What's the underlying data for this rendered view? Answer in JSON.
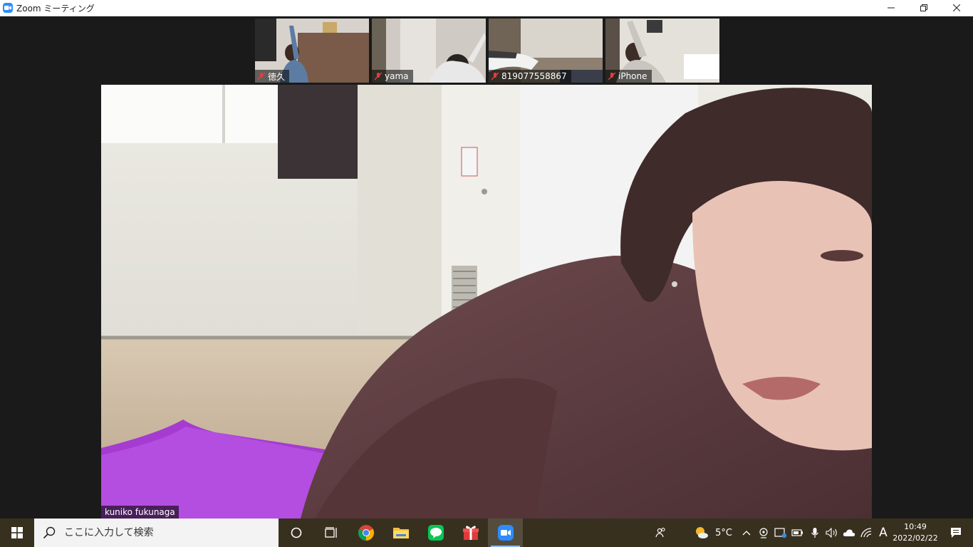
{
  "window": {
    "title": "Zoom ミーティング",
    "controls": [
      "minimize",
      "restore",
      "close"
    ]
  },
  "participants": [
    {
      "name": "徳久",
      "muted": true
    },
    {
      "name": "yama",
      "muted": true
    },
    {
      "name": "819077558867",
      "muted": true
    },
    {
      "name": "iPhone",
      "muted": true
    }
  ],
  "active_speaker": {
    "name": "kuniko fukunaga"
  },
  "taskbar": {
    "search_placeholder": "ここに入力して検索",
    "apps": [
      "cortana-icon",
      "task-view-icon",
      "chrome-icon",
      "file-explorer-icon",
      "line-icon",
      "gift-icon",
      "zoom-icon"
    ],
    "active_app": "zoom-icon"
  },
  "tray": {
    "temperature": "5°C",
    "time": "10:49",
    "date": "2022/02/22",
    "ime": "A"
  },
  "colors": {
    "zoom_blue": "#2d8cff",
    "taskbar_bg": "#38301f",
    "meeting_bg": "#1a1a1a"
  }
}
